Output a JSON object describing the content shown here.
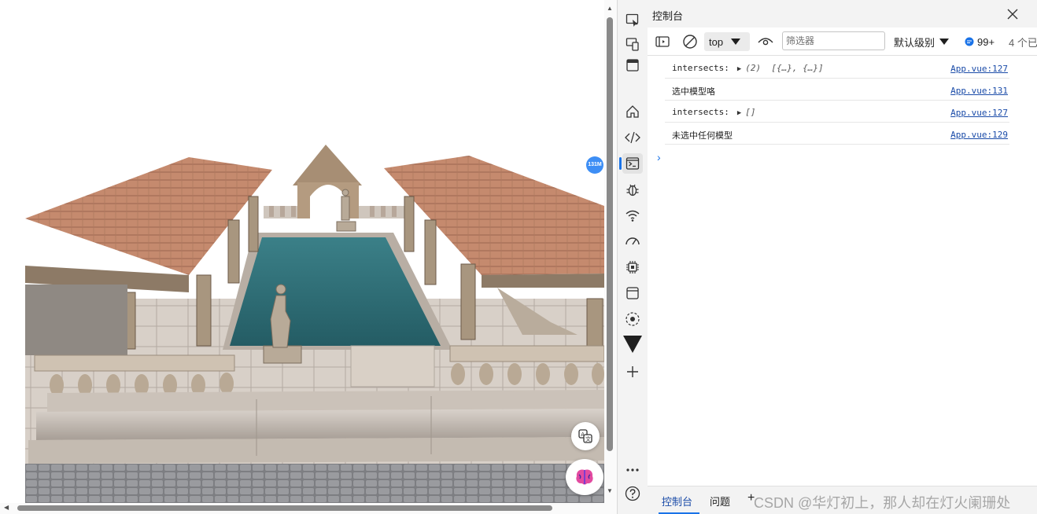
{
  "viewport": {
    "memory_badge": "131M",
    "translate_icon": "translate-icon",
    "copilot_icon": "copilot-brain-icon"
  },
  "activity_bar": {
    "items": [
      {
        "name": "inspect-element-icon"
      },
      {
        "name": "device-emulation-icon"
      },
      {
        "name": "toggle-panel-icon"
      },
      {
        "name": "home-icon"
      },
      {
        "name": "elements-icon"
      },
      {
        "name": "console-icon",
        "active": true
      },
      {
        "name": "sources-bug-icon"
      },
      {
        "name": "network-icon"
      },
      {
        "name": "performance-icon"
      },
      {
        "name": "memory-chip-icon"
      },
      {
        "name": "application-icon"
      },
      {
        "name": "sensors-icon"
      },
      {
        "name": "vue-devtools-icon"
      },
      {
        "name": "add-tool-icon"
      },
      {
        "name": "more-tools-icon"
      },
      {
        "name": "help-icon"
      }
    ]
  },
  "devtools": {
    "title": "控制台",
    "toolbar": {
      "context": "top",
      "filter_placeholder": "筛选器",
      "level": "默认级别",
      "message_count": "99+",
      "issues": "4 个已"
    },
    "console_rows": [
      {
        "label": "intersects:",
        "count": "(2)",
        "value": "[{…}, {…}]",
        "expandable": true,
        "source": "App.vue:127"
      },
      {
        "label": "选中模型咯",
        "count": "",
        "value": "",
        "expandable": false,
        "source": "App.vue:131"
      },
      {
        "label": "intersects:",
        "count": "",
        "value": "[]",
        "expandable": true,
        "source": "App.vue:127"
      },
      {
        "label": "未选中任何模型",
        "count": "",
        "value": "",
        "expandable": false,
        "source": "App.vue:129"
      }
    ],
    "prompt_symbol": "›",
    "bottom_tabs": {
      "console": "控制台",
      "issues": "问题",
      "add": "+"
    },
    "watermark": "CSDN @华灯初上，那人却在灯火阑珊处"
  },
  "colors": {
    "accent": "#1a73e8",
    "water": "#2f6f78",
    "roof": "#c98a6a"
  }
}
